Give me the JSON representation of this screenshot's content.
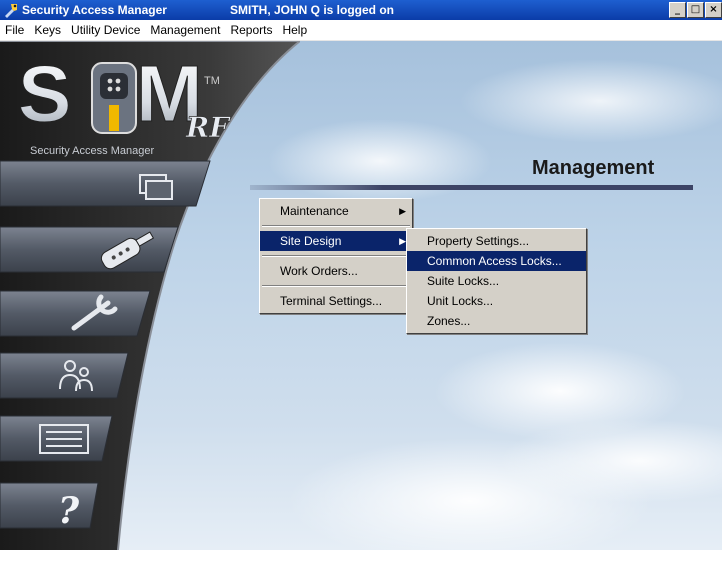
{
  "window": {
    "title": "Security Access Manager",
    "user_status": "SMITH, JOHN Q is logged on",
    "controls": [
      "_",
      "□",
      "×"
    ]
  },
  "menubar": [
    "File",
    "Keys",
    "Utility Device",
    "Management",
    "Reports",
    "Help"
  ],
  "logo": {
    "brand": "SAM",
    "trademark": "TM",
    "suffix": "RF",
    "tagline": "Security Access Manager"
  },
  "sidebar": {
    "buttons": [
      {
        "icon": "folders-icon"
      },
      {
        "icon": "key-fob-icon"
      },
      {
        "icon": "wrench-icon"
      },
      {
        "icon": "users-icon"
      },
      {
        "icon": "list-icon"
      },
      {
        "icon": "help-icon",
        "glyph": "?"
      }
    ]
  },
  "main": {
    "heading": "Management"
  },
  "management_menu": {
    "items": [
      "Maintenance",
      "Site Design",
      "Work Orders...",
      "Terminal Settings..."
    ],
    "selected": "Site Design"
  },
  "site_design_submenu": {
    "items": [
      "Property Settings...",
      "Common Access Locks...",
      "Suite Locks...",
      "Unit Locks...",
      "Zones..."
    ],
    "selected": "Common Access Locks..."
  },
  "colors": {
    "titlebar": "#0b3ca8",
    "menu_highlight": "#0a246a",
    "menu_face": "#d4d0c8",
    "sky": "#bdd3e8",
    "sidebar_dark": "#2a2a2a"
  }
}
